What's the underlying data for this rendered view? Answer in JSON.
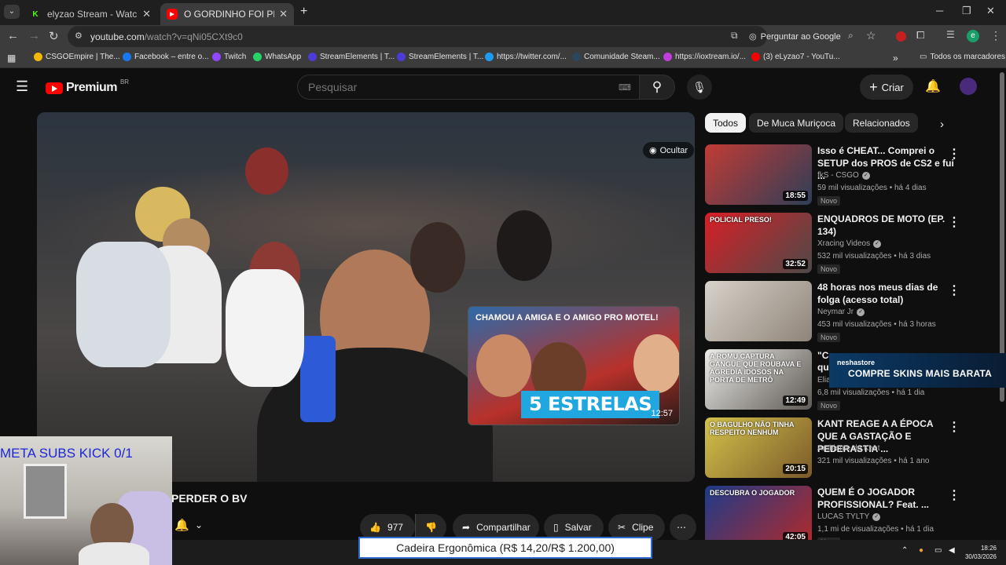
{
  "browser": {
    "tabs": [
      {
        "title": "elyzao Stream - Watch Live on Kick",
        "favicon": "K",
        "color": "#53fc18",
        "active": false
      },
      {
        "title": "O GORDINHO FOI PRA PERDER O BV",
        "favicon": "▶",
        "color": "#ff0000",
        "active": true
      }
    ],
    "new_tab": "+",
    "url_host": "youtube.com",
    "url_path": "/watch?v=qNi05CXt9c0",
    "ask_google": "Perguntar ao Google",
    "avatar_letter": "e",
    "bookmarks": [
      {
        "label": "CSGOEmpire | The...",
        "color": "#f5b800"
      },
      {
        "label": "Facebook – entre o...",
        "color": "#1877f2"
      },
      {
        "label": "Twitch",
        "color": "#9146ff"
      },
      {
        "label": "WhatsApp",
        "color": "#25d366"
      },
      {
        "label": "StreamElements | T...",
        "color": "#4c3bd6"
      },
      {
        "label": "StreamElements | T...",
        "color": "#4c3bd6"
      },
      {
        "label": "https://twitter.com/...",
        "color": "#1d9bf0"
      },
      {
        "label": "Comunidade Steam...",
        "color": "#2a475e"
      },
      {
        "label": "https://ioxtream.io/...",
        "color": "#c03edb"
      },
      {
        "label": "(3) eLyzao7 - YouTu...",
        "color": "#ff0000"
      }
    ],
    "all_bookmarks": "Todos os marcadores"
  },
  "youtube": {
    "logo_text": "Premium",
    "region": "BR",
    "search_placeholder": "Pesquisar",
    "create_label": "Criar"
  },
  "video": {
    "hide_label": "Ocultar",
    "endcard_title": "CHAMOU A AMIGA E O AMIGO PRO MOTEL!",
    "endcard_text": "5 ESTRELAS",
    "endcard_duration": "12:57",
    "title_visible": "PERDER O BV",
    "likes": "977",
    "share_label": "Compartilhar",
    "save_label": "Salvar",
    "clip_label": "Clipe"
  },
  "chips": [
    {
      "label": "Todos",
      "active": true
    },
    {
      "label": "De Muca Muriçoca",
      "active": false
    },
    {
      "label": "Relacionados",
      "active": false
    }
  ],
  "recommendations": [
    {
      "title": "Isso é CHEAT... Comprei o SETUP dos PROS de CS2 e fui ...",
      "channel": "fkS - CSGO",
      "verified": true,
      "meta": "59 mil visualizações • há 4 dias",
      "badge": "Novo",
      "duration": "18:55",
      "thumb_a": "#c23b35",
      "thumb_b": "#2e3e57"
    },
    {
      "title": "ENQUADROS DE MOTO (EP. 134)",
      "channel": "Xracing Videos",
      "verified": true,
      "meta": "532 mil visualizações • há 3 dias",
      "badge": "Novo",
      "duration": "32:52",
      "thumb_a": "#d81f26",
      "thumb_b": "#4d4a48",
      "thumb_text": "POLICIAL PRESO!"
    },
    {
      "title": "48 horas nos meus dias de folga (acesso total)",
      "channel": "Neymar Jr",
      "verified": true,
      "meta": "453 mil visualizações • há 3 horas",
      "badge": "Novo",
      "duration": "",
      "thumb_a": "#d8d2ca",
      "thumb_b": "#8f8479"
    },
    {
      "title": "\"Co",
      "title_rest": "que",
      "channel": "Elia",
      "verified": false,
      "meta": "6,8 mil visualizações • há 1 dia",
      "badge": "Novo",
      "duration": "12:49",
      "thumb_a": "#ecebe8",
      "thumb_b": "#5e5a55",
      "thumb_text": "A ROMU CAPTURA GANGUE QUE ROUBAVA E AGREDIA IDOSOS NA PORTA DE METRÔ"
    },
    {
      "title": "KANT REAGE A A ÉPOCA QUE A GASTAÇÃO E PEDERASTIA ...",
      "channel": "Ambiente de Kant",
      "verified": false,
      "meta": "321 mil visualizações • há 1 ano",
      "badge": "",
      "duration": "20:15",
      "thumb_a": "#d4c24a",
      "thumb_b": "#7a5a2a",
      "thumb_text": "O BAGULHO NÃO TINHA RESPEITO NENHUM"
    },
    {
      "title": "QUEM É O JOGADOR PROFISSIONAL? Feat. ...",
      "channel": "LUCAS TYLTY",
      "verified": true,
      "meta": "1,1 mi de visualizações • há 1 dia",
      "badge": "Novo",
      "duration": "42:05",
      "thumb_a": "#1d3b8a",
      "thumb_b": "#b22a2a",
      "thumb_text": "DESCUBRA O JOGADOR"
    }
  ],
  "overlays": {
    "meta_subs": "META SUBS KICK 0/1",
    "ad_brand": "neshastore",
    "ad_text": "COMPRE SKINS MAIS BARATA",
    "donation": "Cadeira Ergonômica (R$ 14,20/R$ 1.200,00)",
    "time": "18:26",
    "date": "30/03/2026"
  },
  "colors": {
    "accent_red": "#ff0000",
    "bg": "#0f0f0f",
    "chip": "#272727"
  }
}
